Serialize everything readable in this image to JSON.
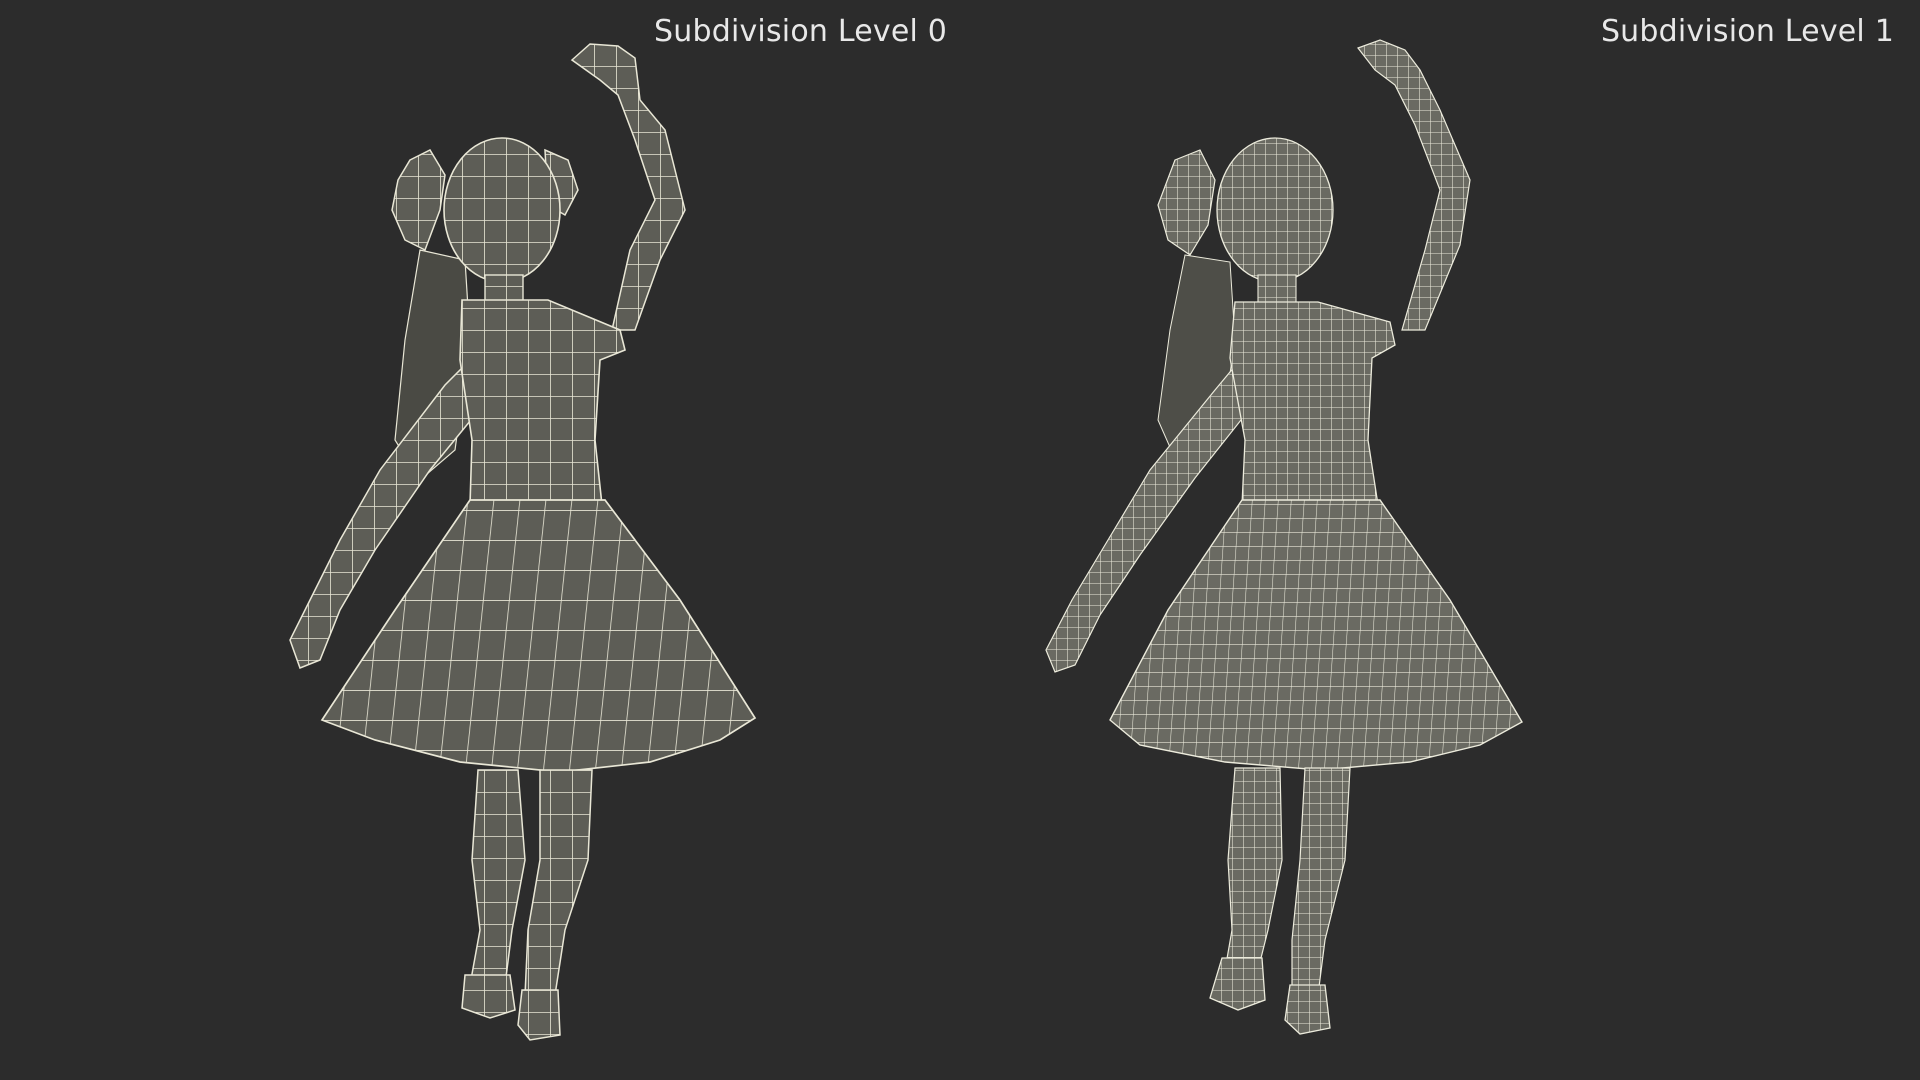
{
  "panels": [
    {
      "label": "Subdivision Level 0"
    },
    {
      "label": "Subdivision Level 1"
    }
  ],
  "subjects": [
    "girl-dancer-wireframe-low",
    "girl-dancer-wireframe-high"
  ],
  "colors": {
    "background": "#2c2c2c",
    "mesh_fill": "#5f5f58",
    "mesh_shade": "#4a4a44",
    "wire": "#e9e7d6",
    "label": "#e8e8e8"
  }
}
